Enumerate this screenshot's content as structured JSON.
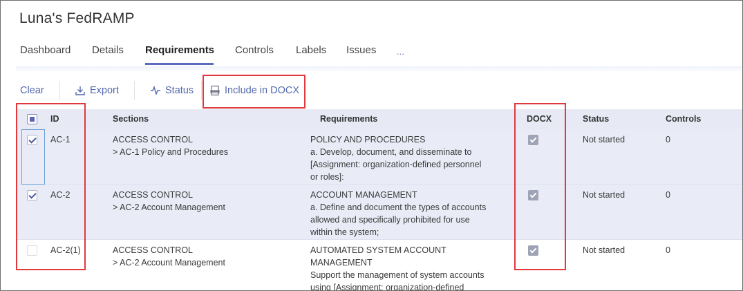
{
  "app": {
    "title": "Luna's FedRAMP"
  },
  "tabs": [
    {
      "label": "Dashboard",
      "active": false
    },
    {
      "label": "Details",
      "active": false
    },
    {
      "label": "Requirements",
      "active": true
    },
    {
      "label": "Controls",
      "active": false
    },
    {
      "label": "Labels",
      "active": false
    },
    {
      "label": "Issues",
      "active": false
    },
    {
      "label": "...",
      "active": false
    }
  ],
  "toolbar": {
    "clear_label": "Clear",
    "export_label": "Export",
    "status_label": "Status",
    "include_docx_label": "Include in DOCX"
  },
  "table": {
    "headers": {
      "id": "ID",
      "sections": "Sections",
      "requirements": "Requirements",
      "docx": "DOCX",
      "status": "Status",
      "controls": "Controls"
    },
    "rows": [
      {
        "selected": true,
        "id": "AC-1",
        "section_line1": "ACCESS CONTROL",
        "section_line2": "> AC-1 Policy and Procedures",
        "requirement": "POLICY AND PROCEDURES\na. Develop, document, and disseminate to\n[Assignment: organization-defined personnel\nor roles]:",
        "docx": true,
        "status": "Not started",
        "controls": "0"
      },
      {
        "selected": true,
        "id": "AC-2",
        "section_line1": "ACCESS CONTROL",
        "section_line2": "> AC-2 Account Management",
        "requirement": "ACCOUNT MANAGEMENT\na. Define and document the types of accounts\nallowed and specifically prohibited for use\nwithin the system;",
        "docx": true,
        "status": "Not started",
        "controls": "0"
      },
      {
        "selected": false,
        "id": "AC-2(1)",
        "section_line1": "ACCESS CONTROL",
        "section_line2": "> AC-2 Account Management",
        "requirement": "AUTOMATED SYSTEM ACCOUNT\nMANAGEMENT\nSupport the management of system accounts\nusing [Assignment: organization-defined",
        "docx": true,
        "status": "Not started",
        "controls": "0"
      }
    ]
  },
  "colors": {
    "accent": "#5b6bbf",
    "link": "#5368ad",
    "annotation": "#e0393e",
    "header_bg": "#e7e9f4",
    "selected_row_bg": "#e9ecf7"
  }
}
